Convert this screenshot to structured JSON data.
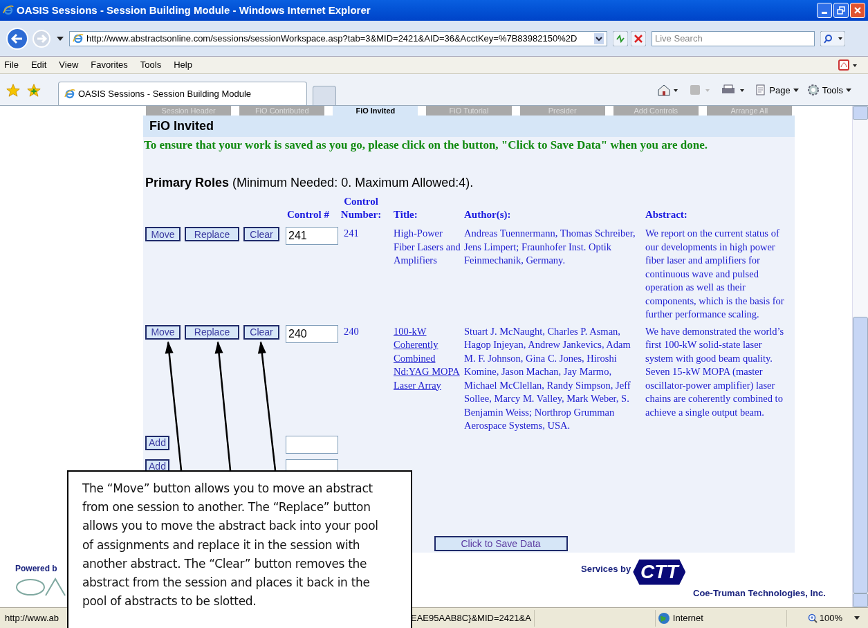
{
  "window": {
    "title": "OASIS Sessions - Session Building Module - Windows Internet Explorer"
  },
  "address_bar": {
    "url": "http://www.abstractsonline.com/sessions/sessionWorkspace.asp?tab=3&MID=2421&AID=36&AcctKey=%7B83982150%2D",
    "search_placeholder": "Live Search"
  },
  "menu": [
    "File",
    "Edit",
    "View",
    "Favorites",
    "Tools",
    "Help"
  ],
  "browser_tab": {
    "title": "OASIS Sessions - Session Building Module"
  },
  "command_bar": [
    "Page",
    "Tools"
  ],
  "page_tabs": [
    {
      "label": "Session Header",
      "selected": false
    },
    {
      "label": "FiO Contributed",
      "selected": false
    },
    {
      "label": "FiO Invited",
      "selected": true
    },
    {
      "label": "FiO Tutorial",
      "selected": false
    },
    {
      "label": "Presider",
      "selected": false
    },
    {
      "label": "Add Controls",
      "selected": false
    },
    {
      "label": "Arrange All",
      "selected": false
    }
  ],
  "section_title": "FiO Invited",
  "notice": "To ensure that your work is saved as you go, please click on the button, \"Click to Save Data\" when you are done.",
  "primary_roles": {
    "label": "Primary Roles",
    "detail": "(Minimum Needed: 0. Maximum Allowed:4)."
  },
  "table": {
    "columns": [
      "Control #",
      "Control Number:",
      "Title:",
      "Author(s):",
      "Abstract:"
    ],
    "rows": [
      {
        "kind": "assigned",
        "buttons": [
          "Move",
          "Replace",
          "Clear"
        ],
        "control": "241",
        "number": "241",
        "title": "High-Power Fiber Lasers and Amplifiers",
        "link": false,
        "authors": "Andreas Tuennermann, Thomas Schreiber, Jens Limpert; Fraunhofer Inst. Optik Feinmechanik, Germany.",
        "abstract": "We report on the current status of our developments in high power fiber laser and amplifiers for continuous wave and pulsed operation as well as their components, which is the basis for further performance scaling."
      },
      {
        "kind": "assigned",
        "buttons": [
          "Move",
          "Replace",
          "Clear"
        ],
        "control": "240",
        "number": "240",
        "title": "100-kW Coherently Combined Nd:YAG MOPA Laser Array",
        "link": true,
        "authors": "Stuart J. McNaught, Charles P. Asman, Hagop Injeyan, Andrew Jankevics, Adam M. F. Johnson, Gina C. Jones, Hiroshi Komine, Jason Machan, Jay Marmo, Michael McClellan, Randy Simpson, Jeff Sollee, Marcy M. Valley, Mark Weber, S. Benjamin Weiss; Northrop Grumman Aerospace Systems, USA.",
        "abstract": "We have demonstrated the world’s first 100-kW solid-state laser system with good beam quality. Seven 15-kW MOPA (master oscillator-power amplifier) laser chains are coherently combined to achieve a single output beam."
      },
      {
        "kind": "empty",
        "buttons": [
          "Add"
        ]
      },
      {
        "kind": "empty",
        "buttons": [
          "Add"
        ]
      }
    ]
  },
  "save_button": "Click to Save Data",
  "footer": {
    "powered_by": "Powered b",
    "services_by": "Services by",
    "logo_text": "CTT",
    "company": "Coe-Truman Technologies, Inc."
  },
  "status_bar": {
    "url_start": "http://www.ab",
    "url_end": "EAE95AAB8C}&MID=2421&A",
    "zone": "Internet",
    "zoom": "100%"
  },
  "callout": "The “Move” button allows you to move an abstract from one session to another. The “Replace” button allows you to move the abstract back into your pool of assignments and replace it in the session with another abstract. The “Clear” button removes the abstract from the session and places it back in the pool of abstracts to be slotted."
}
